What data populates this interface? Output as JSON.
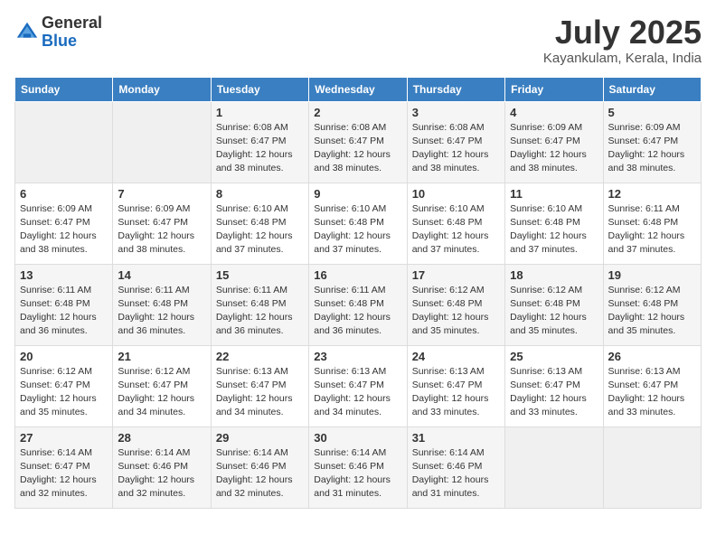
{
  "header": {
    "logo_line1": "General",
    "logo_line2": "Blue",
    "month_title": "July 2025",
    "location": "Kayankulam, Kerala, India"
  },
  "weekdays": [
    "Sunday",
    "Monday",
    "Tuesday",
    "Wednesday",
    "Thursday",
    "Friday",
    "Saturday"
  ],
  "weeks": [
    [
      {
        "day": "",
        "sunrise": "",
        "sunset": "",
        "daylight": ""
      },
      {
        "day": "",
        "sunrise": "",
        "sunset": "",
        "daylight": ""
      },
      {
        "day": "1",
        "sunrise": "Sunrise: 6:08 AM",
        "sunset": "Sunset: 6:47 PM",
        "daylight": "Daylight: 12 hours and 38 minutes."
      },
      {
        "day": "2",
        "sunrise": "Sunrise: 6:08 AM",
        "sunset": "Sunset: 6:47 PM",
        "daylight": "Daylight: 12 hours and 38 minutes."
      },
      {
        "day": "3",
        "sunrise": "Sunrise: 6:08 AM",
        "sunset": "Sunset: 6:47 PM",
        "daylight": "Daylight: 12 hours and 38 minutes."
      },
      {
        "day": "4",
        "sunrise": "Sunrise: 6:09 AM",
        "sunset": "Sunset: 6:47 PM",
        "daylight": "Daylight: 12 hours and 38 minutes."
      },
      {
        "day": "5",
        "sunrise": "Sunrise: 6:09 AM",
        "sunset": "Sunset: 6:47 PM",
        "daylight": "Daylight: 12 hours and 38 minutes."
      }
    ],
    [
      {
        "day": "6",
        "sunrise": "Sunrise: 6:09 AM",
        "sunset": "Sunset: 6:47 PM",
        "daylight": "Daylight: 12 hours and 38 minutes."
      },
      {
        "day": "7",
        "sunrise": "Sunrise: 6:09 AM",
        "sunset": "Sunset: 6:47 PM",
        "daylight": "Daylight: 12 hours and 38 minutes."
      },
      {
        "day": "8",
        "sunrise": "Sunrise: 6:10 AM",
        "sunset": "Sunset: 6:48 PM",
        "daylight": "Daylight: 12 hours and 37 minutes."
      },
      {
        "day": "9",
        "sunrise": "Sunrise: 6:10 AM",
        "sunset": "Sunset: 6:48 PM",
        "daylight": "Daylight: 12 hours and 37 minutes."
      },
      {
        "day": "10",
        "sunrise": "Sunrise: 6:10 AM",
        "sunset": "Sunset: 6:48 PM",
        "daylight": "Daylight: 12 hours and 37 minutes."
      },
      {
        "day": "11",
        "sunrise": "Sunrise: 6:10 AM",
        "sunset": "Sunset: 6:48 PM",
        "daylight": "Daylight: 12 hours and 37 minutes."
      },
      {
        "day": "12",
        "sunrise": "Sunrise: 6:11 AM",
        "sunset": "Sunset: 6:48 PM",
        "daylight": "Daylight: 12 hours and 37 minutes."
      }
    ],
    [
      {
        "day": "13",
        "sunrise": "Sunrise: 6:11 AM",
        "sunset": "Sunset: 6:48 PM",
        "daylight": "Daylight: 12 hours and 36 minutes."
      },
      {
        "day": "14",
        "sunrise": "Sunrise: 6:11 AM",
        "sunset": "Sunset: 6:48 PM",
        "daylight": "Daylight: 12 hours and 36 minutes."
      },
      {
        "day": "15",
        "sunrise": "Sunrise: 6:11 AM",
        "sunset": "Sunset: 6:48 PM",
        "daylight": "Daylight: 12 hours and 36 minutes."
      },
      {
        "day": "16",
        "sunrise": "Sunrise: 6:11 AM",
        "sunset": "Sunset: 6:48 PM",
        "daylight": "Daylight: 12 hours and 36 minutes."
      },
      {
        "day": "17",
        "sunrise": "Sunrise: 6:12 AM",
        "sunset": "Sunset: 6:48 PM",
        "daylight": "Daylight: 12 hours and 35 minutes."
      },
      {
        "day": "18",
        "sunrise": "Sunrise: 6:12 AM",
        "sunset": "Sunset: 6:48 PM",
        "daylight": "Daylight: 12 hours and 35 minutes."
      },
      {
        "day": "19",
        "sunrise": "Sunrise: 6:12 AM",
        "sunset": "Sunset: 6:48 PM",
        "daylight": "Daylight: 12 hours and 35 minutes."
      }
    ],
    [
      {
        "day": "20",
        "sunrise": "Sunrise: 6:12 AM",
        "sunset": "Sunset: 6:47 PM",
        "daylight": "Daylight: 12 hours and 35 minutes."
      },
      {
        "day": "21",
        "sunrise": "Sunrise: 6:12 AM",
        "sunset": "Sunset: 6:47 PM",
        "daylight": "Daylight: 12 hours and 34 minutes."
      },
      {
        "day": "22",
        "sunrise": "Sunrise: 6:13 AM",
        "sunset": "Sunset: 6:47 PM",
        "daylight": "Daylight: 12 hours and 34 minutes."
      },
      {
        "day": "23",
        "sunrise": "Sunrise: 6:13 AM",
        "sunset": "Sunset: 6:47 PM",
        "daylight": "Daylight: 12 hours and 34 minutes."
      },
      {
        "day": "24",
        "sunrise": "Sunrise: 6:13 AM",
        "sunset": "Sunset: 6:47 PM",
        "daylight": "Daylight: 12 hours and 33 minutes."
      },
      {
        "day": "25",
        "sunrise": "Sunrise: 6:13 AM",
        "sunset": "Sunset: 6:47 PM",
        "daylight": "Daylight: 12 hours and 33 minutes."
      },
      {
        "day": "26",
        "sunrise": "Sunrise: 6:13 AM",
        "sunset": "Sunset: 6:47 PM",
        "daylight": "Daylight: 12 hours and 33 minutes."
      }
    ],
    [
      {
        "day": "27",
        "sunrise": "Sunrise: 6:14 AM",
        "sunset": "Sunset: 6:47 PM",
        "daylight": "Daylight: 12 hours and 32 minutes."
      },
      {
        "day": "28",
        "sunrise": "Sunrise: 6:14 AM",
        "sunset": "Sunset: 6:46 PM",
        "daylight": "Daylight: 12 hours and 32 minutes."
      },
      {
        "day": "29",
        "sunrise": "Sunrise: 6:14 AM",
        "sunset": "Sunset: 6:46 PM",
        "daylight": "Daylight: 12 hours and 32 minutes."
      },
      {
        "day": "30",
        "sunrise": "Sunrise: 6:14 AM",
        "sunset": "Sunset: 6:46 PM",
        "daylight": "Daylight: 12 hours and 31 minutes."
      },
      {
        "day": "31",
        "sunrise": "Sunrise: 6:14 AM",
        "sunset": "Sunset: 6:46 PM",
        "daylight": "Daylight: 12 hours and 31 minutes."
      },
      {
        "day": "",
        "sunrise": "",
        "sunset": "",
        "daylight": ""
      },
      {
        "day": "",
        "sunrise": "",
        "sunset": "",
        "daylight": ""
      }
    ]
  ]
}
